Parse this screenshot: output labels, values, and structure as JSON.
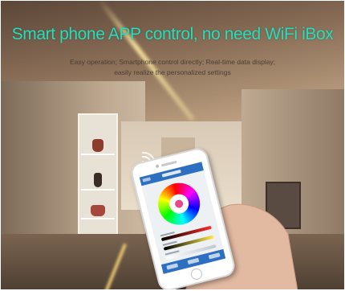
{
  "headline": "Smart phone APP control, no need WiFi iBox",
  "subtext": {
    "line1": "Easy operation; Smartphone control directly; Real-time data display;",
    "line2": "easily realize the personalized settings"
  },
  "colors": {
    "headline": "#22e0bd",
    "app_bar": "#2d6fc0",
    "power_button": "#e74a8b"
  },
  "icons": [
    "wifi-signal-icon",
    "power-icon",
    "color-wheel-icon"
  ]
}
